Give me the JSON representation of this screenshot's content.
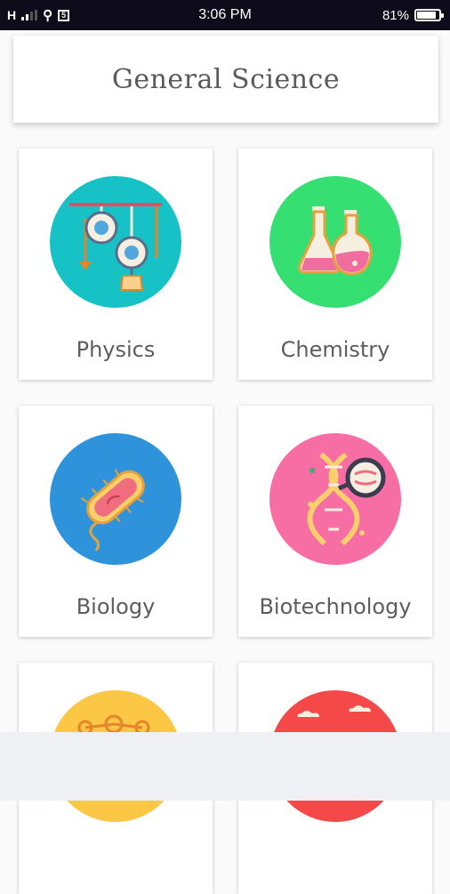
{
  "status_bar": {
    "network": "H",
    "time": "3:06 PM",
    "battery": "81%"
  },
  "header": {
    "title": "General Science"
  },
  "categories": [
    {
      "label": "Physics",
      "color": "#17c2c6",
      "icon": "pulley-icon"
    },
    {
      "label": "Chemistry",
      "color": "#35df71",
      "icon": "flasks-icon"
    },
    {
      "label": "Biology",
      "color": "#2f93dc",
      "icon": "bacteria-icon"
    },
    {
      "label": "Biotechnology",
      "color": "#f76ea5",
      "icon": "dna-magnifier-icon"
    },
    {
      "label": "",
      "color": "#fbc744",
      "icon": "molecule-icon"
    },
    {
      "label": "",
      "color": "#f54848",
      "icon": "sky-icon"
    }
  ]
}
